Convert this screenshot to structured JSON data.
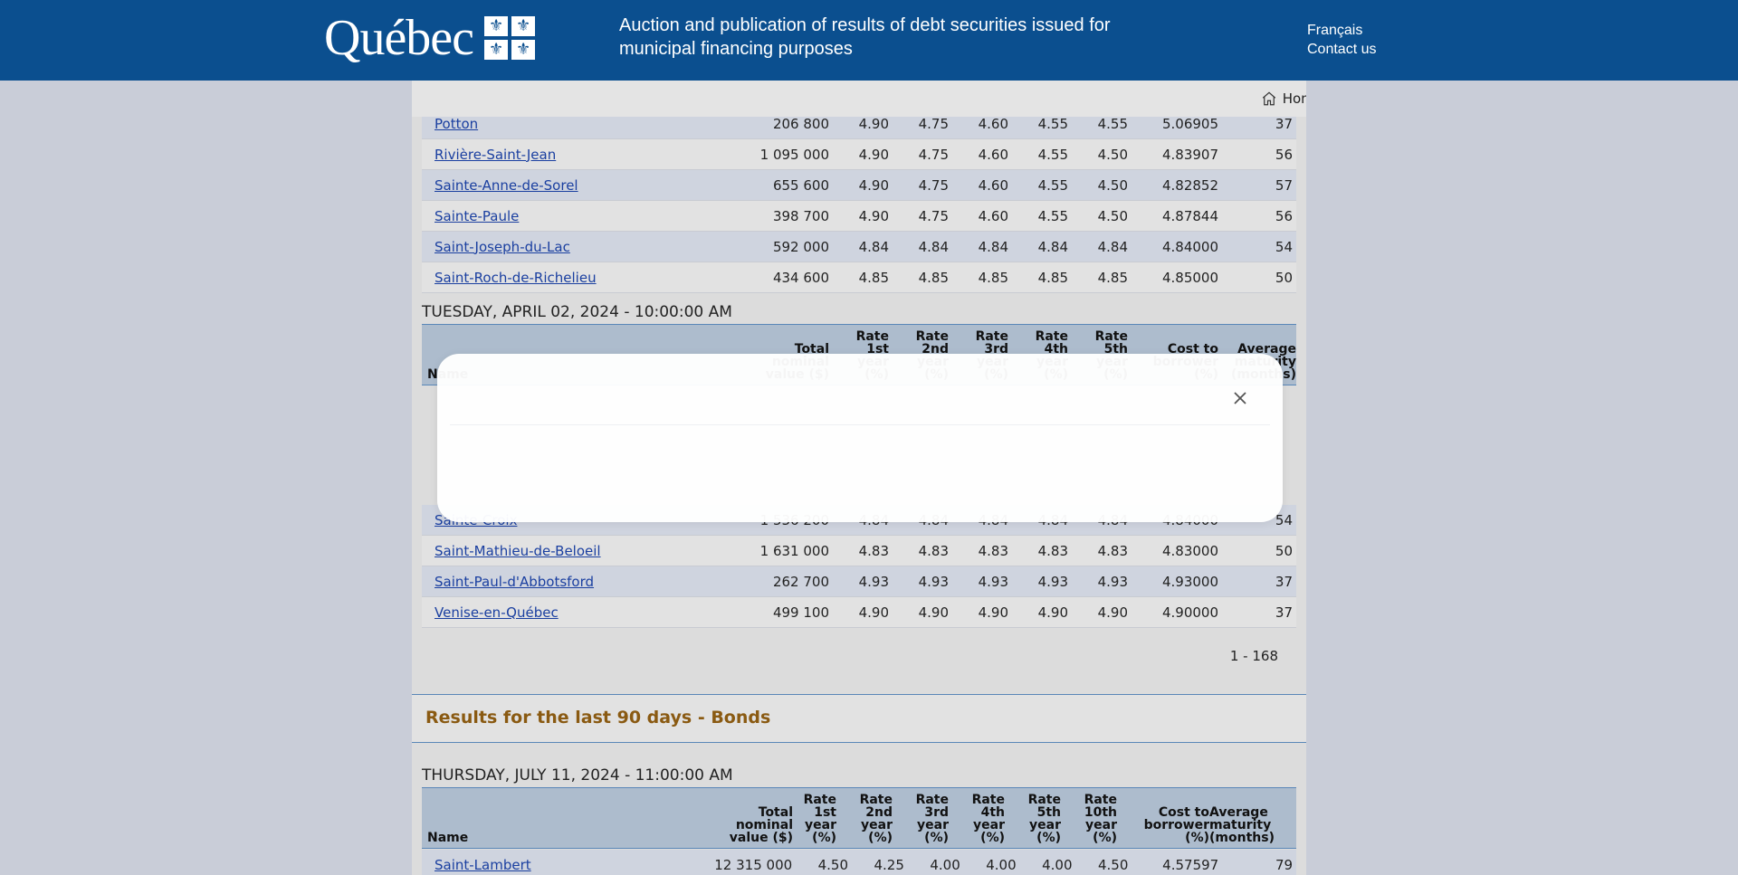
{
  "header": {
    "logo_text": "Québec",
    "site_title": "Auction and publication of results of debt securities issued for municipal financing purposes",
    "links": [
      "Français",
      "Contact us"
    ]
  },
  "nav": {
    "home_label": "Home",
    "home_icon": "home-icon"
  },
  "columns": {
    "name": "Name",
    "total": "Total\nnominal\nvalue ($)",
    "r1": "Rate\n1st\nyear\n(%)",
    "r2": "Rate\n2nd\nyear\n(%)",
    "r3": "Rate\n3rd\nyear\n(%)",
    "r4": "Rate\n4th\nyear\n(%)",
    "r5": "Rate\n5th\nyear\n(%)",
    "r10": "Rate\n10th\nyear\n(%)",
    "cost": "Cost to\nborrower\n(%)",
    "avg": "Average\nmaturity\n(months)"
  },
  "block1_rows": [
    [
      "Potton",
      "206 800",
      "4.90",
      "4.75",
      "4.60",
      "4.55",
      "4.55",
      "5.06905",
      "37"
    ],
    [
      "Rivière-Saint-Jean",
      "1 095 000",
      "4.90",
      "4.75",
      "4.60",
      "4.55",
      "4.50",
      "4.83907",
      "56"
    ],
    [
      "Sainte-Anne-de-Sorel",
      "655 600",
      "4.90",
      "4.75",
      "4.60",
      "4.55",
      "4.50",
      "4.82852",
      "57"
    ],
    [
      "Sainte-Paule",
      "398 700",
      "4.90",
      "4.75",
      "4.60",
      "4.55",
      "4.50",
      "4.87844",
      "56"
    ],
    [
      "Saint-Joseph-du-Lac",
      "592 000",
      "4.84",
      "4.84",
      "4.84",
      "4.84",
      "4.84",
      "4.84000",
      "54"
    ],
    [
      "Saint-Roch-de-Richelieu",
      "434 600",
      "4.85",
      "4.85",
      "4.85",
      "4.85",
      "4.85",
      "4.85000",
      "50"
    ]
  ],
  "block2": {
    "date": "TUESDAY, APRIL 02, 2024 - 10:00:00 AM",
    "rows": [
      [
        "Sainte-Croix",
        "1 536 200",
        "4.84",
        "4.84",
        "4.84",
        "4.84",
        "4.84",
        "4.84000",
        "54"
      ],
      [
        "Saint-Mathieu-de-Beloeil",
        "1 631 000",
        "4.83",
        "4.83",
        "4.83",
        "4.83",
        "4.83",
        "4.83000",
        "50"
      ],
      [
        "Saint-Paul-d'Abbotsford",
        "262 700",
        "4.93",
        "4.93",
        "4.93",
        "4.93",
        "4.93",
        "4.93000",
        "37"
      ],
      [
        "Venise-en-Québec",
        "499 100",
        "4.90",
        "4.90",
        "4.90",
        "4.90",
        "4.90",
        "4.90000",
        "37"
      ]
    ]
  },
  "pager": "1 - 168",
  "section_title": "Results for the last 90 days - Bonds",
  "block3": {
    "date": "THURSDAY, JULY 11, 2024 - 11:00:00 AM",
    "rows": [
      [
        "Saint-Lambert",
        "12 315 000",
        "4.50",
        "4.25",
        "4.00",
        "4.00",
        "4.00",
        "4.50",
        "4.57597",
        "79"
      ]
    ]
  },
  "modal": {
    "close_icon": "close-icon"
  }
}
